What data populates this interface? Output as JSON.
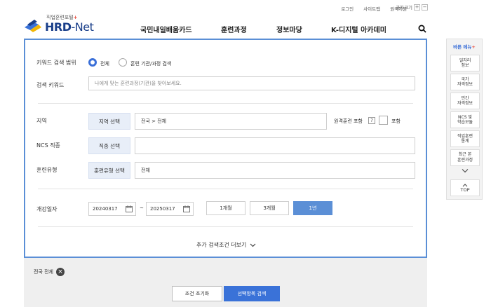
{
  "header": {
    "util_links": [
      "로그인",
      "사이트맵",
      "원격지원"
    ],
    "font_size_label": "글자크기",
    "font_plus": "+",
    "font_minus": "−",
    "logo_sub": "직업훈련포털",
    "logo_plus": "+",
    "logo_main_a": "HRD",
    "logo_main_b": "-Net",
    "nav": [
      "국민내일배움카드",
      "훈련과정",
      "정보마당",
      "K-디지털 아카데미"
    ]
  },
  "form": {
    "keyword_scope_label": "키워드 검색 범위",
    "scope_options": [
      "전체",
      "훈련 기관/과정 검색"
    ],
    "scope_selected": "전체",
    "keyword_label": "검색 키워드",
    "keyword_placeholder": "나에게 맞는 훈련과정(기관)을 찾아보세요.",
    "region_label": "지역",
    "region_button": "지역 선택",
    "region_value": "전국 > 전체",
    "remote_label": "원격훈련 포함",
    "remote_help": "?",
    "remote_checkbox_label": "포함",
    "ncs_label": "NCS 직종",
    "ncs_button": "직종 선택",
    "ncs_value": "",
    "type_label": "훈련유형",
    "type_button": "훈련유형 선택",
    "type_value": "전체",
    "date_label": "개강일자",
    "date_start": "20240317",
    "date_sep": "~",
    "date_end": "20250317",
    "periods": [
      "1개월",
      "3개월",
      "1년"
    ],
    "period_selected": "1년",
    "more_label": "추가 검색조건 더보기"
  },
  "bottom": {
    "chip_label": "전국 전체",
    "reset_label": "조건 초기화",
    "search_label": "선택항목 검색"
  },
  "quick_menu": {
    "title": "바른 메뉴",
    "title_plus": "+",
    "items": [
      "일자리\n정보",
      "국가\n자격정보",
      "민간\n자격정보",
      "NCS 및\n학습모듈",
      "직업훈련\n통계",
      "최근 본\n훈련과정"
    ],
    "top_label": "TOP"
  },
  "colors": {
    "accent": "#3a72d8",
    "panel_border": "#5b8fd6",
    "logo_blue": "#1a3f8a"
  }
}
